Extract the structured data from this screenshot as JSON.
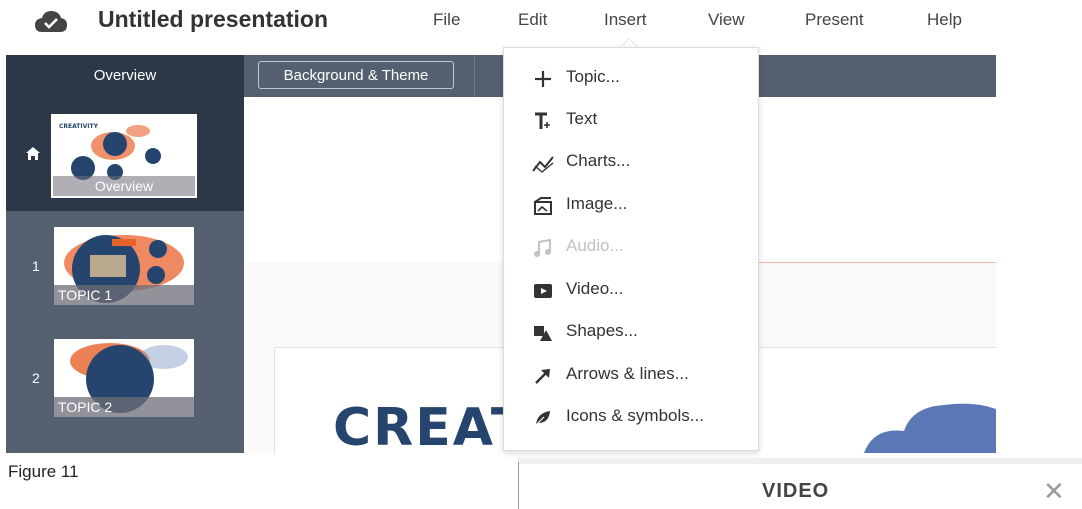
{
  "header": {
    "title": "Untitled presentation",
    "menu": [
      "File",
      "Edit",
      "Insert",
      "View",
      "Present",
      "Help"
    ]
  },
  "sidebar": {
    "heading": "Overview",
    "overview_thumb_label": "Overview",
    "slides": [
      {
        "number": "1",
        "label": "TOPIC 1"
      },
      {
        "number": "2",
        "label": "TOPIC 2"
      }
    ]
  },
  "toolbar": {
    "background_button": "Background & Theme"
  },
  "insert_menu": {
    "items": [
      {
        "label": "Topic...",
        "icon": "plus-icon",
        "enabled": true
      },
      {
        "label": "Text",
        "icon": "text-icon",
        "enabled": true
      },
      {
        "label": "Charts...",
        "icon": "chart-icon",
        "enabled": true
      },
      {
        "label": "Image...",
        "icon": "image-icon",
        "enabled": true
      },
      {
        "label": "Audio...",
        "icon": "music-note-icon",
        "enabled": false
      },
      {
        "label": "Video...",
        "icon": "video-play-icon",
        "enabled": true
      },
      {
        "label": "Shapes...",
        "icon": "shapes-icon",
        "enabled": true
      },
      {
        "label": "Arrows & lines...",
        "icon": "arrow-icon",
        "enabled": true
      },
      {
        "label": "Icons & symbols...",
        "icon": "leaf-icon",
        "enabled": true
      }
    ]
  },
  "canvas": {
    "title_partial": "CREAT"
  },
  "figure_caption": "Figure 11",
  "bottom_panel": {
    "heading": "VIDEO",
    "close_symbol": "✕"
  },
  "colors": {
    "sidebar_dark": "#2c3748",
    "sidebar": "#545f70",
    "accent_blue": "#26456e",
    "accent_orange": "#e8622c"
  }
}
